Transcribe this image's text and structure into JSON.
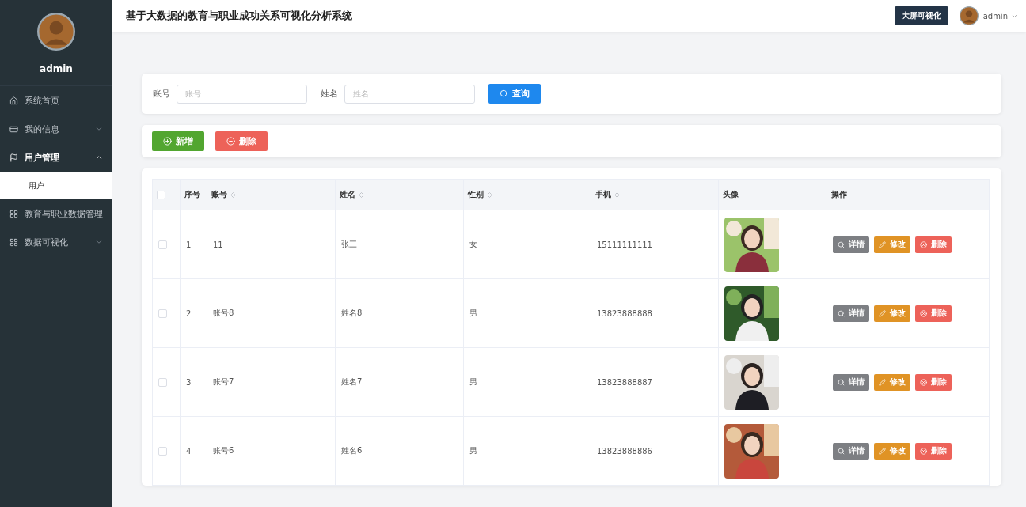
{
  "sidebar": {
    "username": "admin",
    "menu": [
      {
        "label": "系统首页",
        "kind": "link",
        "selected": false
      },
      {
        "label": "我的信息",
        "kind": "submenu",
        "expanded": false,
        "selected": false
      },
      {
        "label": "用户管理",
        "kind": "submenu",
        "expanded": true,
        "selected": true,
        "children": [
          {
            "label": "用户",
            "selected": true
          }
        ]
      },
      {
        "label": "教育与职业数据管理",
        "kind": "link",
        "selected": false
      },
      {
        "label": "数据可视化",
        "kind": "submenu",
        "expanded": false,
        "selected": false
      }
    ]
  },
  "header": {
    "title": "基于大数据的教育与职业成功关系可视化分析系统",
    "screen_button": "大屏可视化",
    "user": "admin"
  },
  "search": {
    "fields": [
      {
        "label": "账号",
        "placeholder": "账号"
      },
      {
        "label": "姓名",
        "placeholder": "姓名"
      }
    ],
    "button": "查询"
  },
  "actions": [
    {
      "label": "新增",
      "kind": "add"
    },
    {
      "label": "删除",
      "kind": "delete"
    }
  ],
  "table": {
    "select_all": {
      "checked": false
    },
    "columns": [
      {
        "label": "序号",
        "sortable": false
      },
      {
        "label": "账号",
        "sortable": true
      },
      {
        "label": "姓名",
        "sortable": true
      },
      {
        "label": "性别",
        "sortable": true
      },
      {
        "label": "手机",
        "sortable": true
      },
      {
        "label": "头像",
        "sortable": false
      },
      {
        "label": "操作",
        "sortable": false
      }
    ],
    "rows": [
      {
        "checked": false,
        "index": "1",
        "account": "11",
        "name": "张三",
        "gender": "女",
        "phone": "15111111111",
        "photo": {
          "kind": "picture"
        },
        "actions": [
          {
            "label": "详情",
            "kind": "detail"
          },
          {
            "label": "修改",
            "kind": "edit"
          },
          {
            "label": "删除",
            "kind": "delete"
          }
        ]
      },
      {
        "checked": false,
        "index": "2",
        "account": "账号8",
        "name": "姓名8",
        "gender": "男",
        "phone": "13823888888",
        "photo": {
          "kind": "picture"
        },
        "actions": [
          {
            "label": "详情",
            "kind": "detail"
          },
          {
            "label": "修改",
            "kind": "edit"
          },
          {
            "label": "删除",
            "kind": "delete"
          }
        ]
      },
      {
        "checked": false,
        "index": "3",
        "account": "账号7",
        "name": "姓名7",
        "gender": "男",
        "phone": "13823888887",
        "photo": {
          "kind": "picture"
        },
        "actions": [
          {
            "label": "详情",
            "kind": "detail"
          },
          {
            "label": "修改",
            "kind": "edit"
          },
          {
            "label": "删除",
            "kind": "delete"
          }
        ]
      },
      {
        "checked": false,
        "index": "4",
        "account": "账号6",
        "name": "姓名6",
        "gender": "男",
        "phone": "13823888886",
        "photo": {
          "kind": "picture"
        },
        "actions": [
          {
            "label": "详情",
            "kind": "detail"
          },
          {
            "label": "修改",
            "kind": "edit"
          },
          {
            "label": "删除",
            "kind": "delete"
          }
        ]
      }
    ]
  }
}
